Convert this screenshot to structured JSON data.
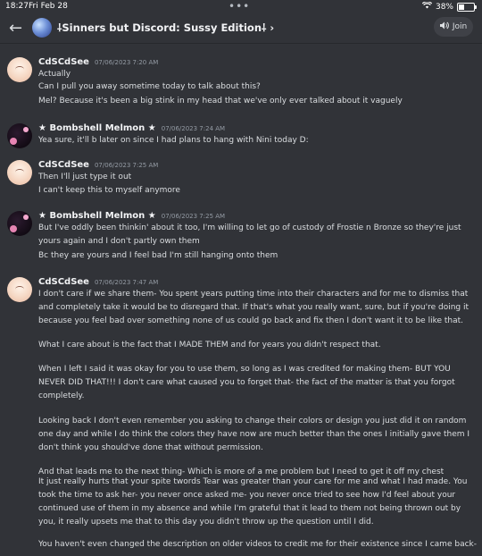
{
  "status": {
    "time": "18:27",
    "date": "Fri Feb 28",
    "battery": "38%",
    "battery_level": 0.38
  },
  "header": {
    "back_icon": "arrow-left-icon",
    "title": "⸸Sinners but Discord: Sussy Edition⸸ ›",
    "join_label": "Join"
  },
  "messages": [
    {
      "author": "CdSCdSee",
      "timestamp": "07/06/2023 7:20 AM",
      "lines": [
        "Actually",
        "Can I pull you away sometime today to talk about this?",
        "Mel? Because it's been a big stink in my head that we've only ever talked about it vaguely"
      ]
    },
    {
      "author": "★ Bombshell Melmon ★",
      "timestamp": "07/06/2023 7:24 AM",
      "lines": [
        "Yea sure, it'll b later on since I had plans to hang with Nini today D:"
      ]
    },
    {
      "author": "CdSCdSee",
      "timestamp": "07/06/2023 7:25 AM",
      "lines": [
        "Then I'll just type it out",
        "I can't keep this to myself anymore"
      ]
    },
    {
      "author": "★ Bombshell Melmon ★",
      "timestamp": "07/06/2023 7:25 AM",
      "lines": [
        "But I've oddly been thinkin' about it too, I'm willing to let go of custody of Frostie n Bronze so they're just",
        "yours again and I don't partly own them",
        "Bc they are yours and I feel bad I'm still hanging onto them"
      ]
    },
    {
      "author": "CdSCdSee",
      "timestamp": "07/06/2023 7:47 AM",
      "paragraphs": [
        "I don't care if we share them- You spent years putting time into their characters and for me to dismiss that and completely take it would be to disregard that. If that's what you really want, sure, but if you're doing it because you feel bad over something none of us could go back and fix then I don't want it to be like that.",
        "What I care about is the fact that I MADE THEM and for years you didn't respect that.",
        "When I left I said it was okay for you to use them, so long as I was credited for making them- BUT YOU NEVER DID THAT!!! I don't care what caused you to forget that- the fact of the matter is that you forgot completely.",
        "Looking back I don't even remember you asking to change their colors or design you just did it on random one day and while I do think the colors they have now are much better than the ones I initially gave them I don't think you should've done that without permission.",
        "And that leads me to the next thing- Which is more of a me problem but I need to get it off my chest",
        "It just really hurts that your spite twords Tear was greater than your care for me and what I had made. You took the time to ask her- you never once asked me- you never once tried to see how I'd feel about your continued use of them in my absence and while I'm grateful that it lead to them not being thrown out by you, it really upsets me that to this day you didn't throw up the question until I did.",
        "You haven't even changed the description on older videos to credit me for their existence since I came back-"
      ]
    }
  ]
}
